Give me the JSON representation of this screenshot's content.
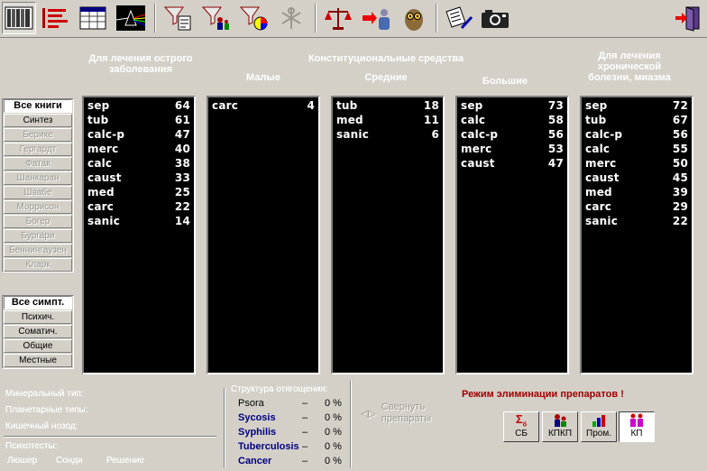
{
  "toolbar": {
    "icons": [
      "books-view-icon",
      "list-view-icon",
      "table-view-icon",
      "prism-icon",
      "funnel-document-icon",
      "funnel-people-icon",
      "funnel-chart-icon",
      "symbol-icon",
      "scales-icon",
      "arrow-person-icon",
      "owl-icon",
      "document-pen-icon",
      "camera-icon",
      "exit-door-icon"
    ]
  },
  "headers": {
    "acute": "Для лечения острого заболевания",
    "constitutional": "Конституциональные средства",
    "small": "Малые",
    "medium": "Средние",
    "large": "Большие",
    "chronic": "Для лечения хронической болезни, миазма"
  },
  "books": [
    {
      "label": "Все книги",
      "state": "active"
    },
    {
      "label": "Синтез",
      "state": "normal"
    },
    {
      "label": "Берике",
      "state": "disabled"
    },
    {
      "label": "Гергардт",
      "state": "disabled"
    },
    {
      "label": "Фатак",
      "state": "disabled"
    },
    {
      "label": "Шанкаран",
      "state": "disabled"
    },
    {
      "label": "Швабе",
      "state": "disabled"
    },
    {
      "label": "Моррисон",
      "state": "disabled"
    },
    {
      "label": "Богер",
      "state": "disabled"
    },
    {
      "label": "Бургари",
      "state": "disabled"
    },
    {
      "label": "Беннингаузен",
      "state": "disabled"
    },
    {
      "label": "Кларк",
      "state": "disabled"
    }
  ],
  "symptoms": [
    {
      "label": "Все симпт.",
      "state": "active"
    },
    {
      "label": "Психич.",
      "state": "normal"
    },
    {
      "label": "Соматич.",
      "state": "normal"
    },
    {
      "label": "Общие",
      "state": "normal"
    },
    {
      "label": "Местные",
      "state": "normal"
    }
  ],
  "lists": {
    "acute": [
      [
        "sep",
        "64"
      ],
      [
        "tub",
        "61"
      ],
      [
        "calc-p",
        "47"
      ],
      [
        "merc",
        "40"
      ],
      [
        "calc",
        "38"
      ],
      [
        "caust",
        "33"
      ],
      [
        "med",
        "25"
      ],
      [
        "carc",
        "22"
      ],
      [
        "sanic",
        "14"
      ]
    ],
    "small": [
      [
        "carc",
        "4"
      ]
    ],
    "medium": [
      [
        "tub",
        "18"
      ],
      [
        "med",
        "11"
      ],
      [
        "sanic",
        "6"
      ]
    ],
    "large": [
      [
        "sep",
        "73"
      ],
      [
        "calc",
        "58"
      ],
      [
        "calc-p",
        "56"
      ],
      [
        "merc",
        "53"
      ],
      [
        "caust",
        "47"
      ]
    ],
    "chronic": [
      [
        "sep",
        "72"
      ],
      [
        "tub",
        "67"
      ],
      [
        "calc-p",
        "56"
      ],
      [
        "calc",
        "55"
      ],
      [
        "merc",
        "50"
      ],
      [
        "caust",
        "45"
      ],
      [
        "med",
        "39"
      ],
      [
        "carc",
        "29"
      ],
      [
        "sanic",
        "22"
      ]
    ]
  },
  "bottom": {
    "mineral_type": "Минеральный тип:",
    "planetary_types": "Планетарные типы:",
    "bowel_nosode": "Кишечный нозод:",
    "psychotests": "Психотесты:",
    "luscher": "Люшер",
    "szondi": "Сонди",
    "solution": "Решение",
    "structure_title": "Структура отягощения:",
    "miasms": [
      {
        "name": "Psora",
        "dash": "–",
        "pct": "0 %",
        "color": "#000000"
      },
      {
        "name": "Sycosis",
        "dash": "–",
        "pct": "0 %",
        "color": "#000080"
      },
      {
        "name": "Syphilis",
        "dash": "–",
        "pct": "0 %",
        "color": "#000080"
      },
      {
        "name": "Tuberculosis",
        "dash": "–",
        "pct": "0 %",
        "color": "#000080"
      },
      {
        "name": "Cancer",
        "dash": "–",
        "pct": "0 %",
        "color": "#000080"
      }
    ],
    "collapse_label": "Свернуть препараты",
    "elimination_mode": "Режим элиминации препаратов !",
    "buttons": [
      {
        "label": "СБ",
        "icon": "sigma-icon"
      },
      {
        "label": "КПКП",
        "icon": "people-icon"
      },
      {
        "label": "Пром.",
        "icon": "bar-chart-icon"
      },
      {
        "label": "КП",
        "icon": "persons-pair-icon"
      }
    ]
  }
}
